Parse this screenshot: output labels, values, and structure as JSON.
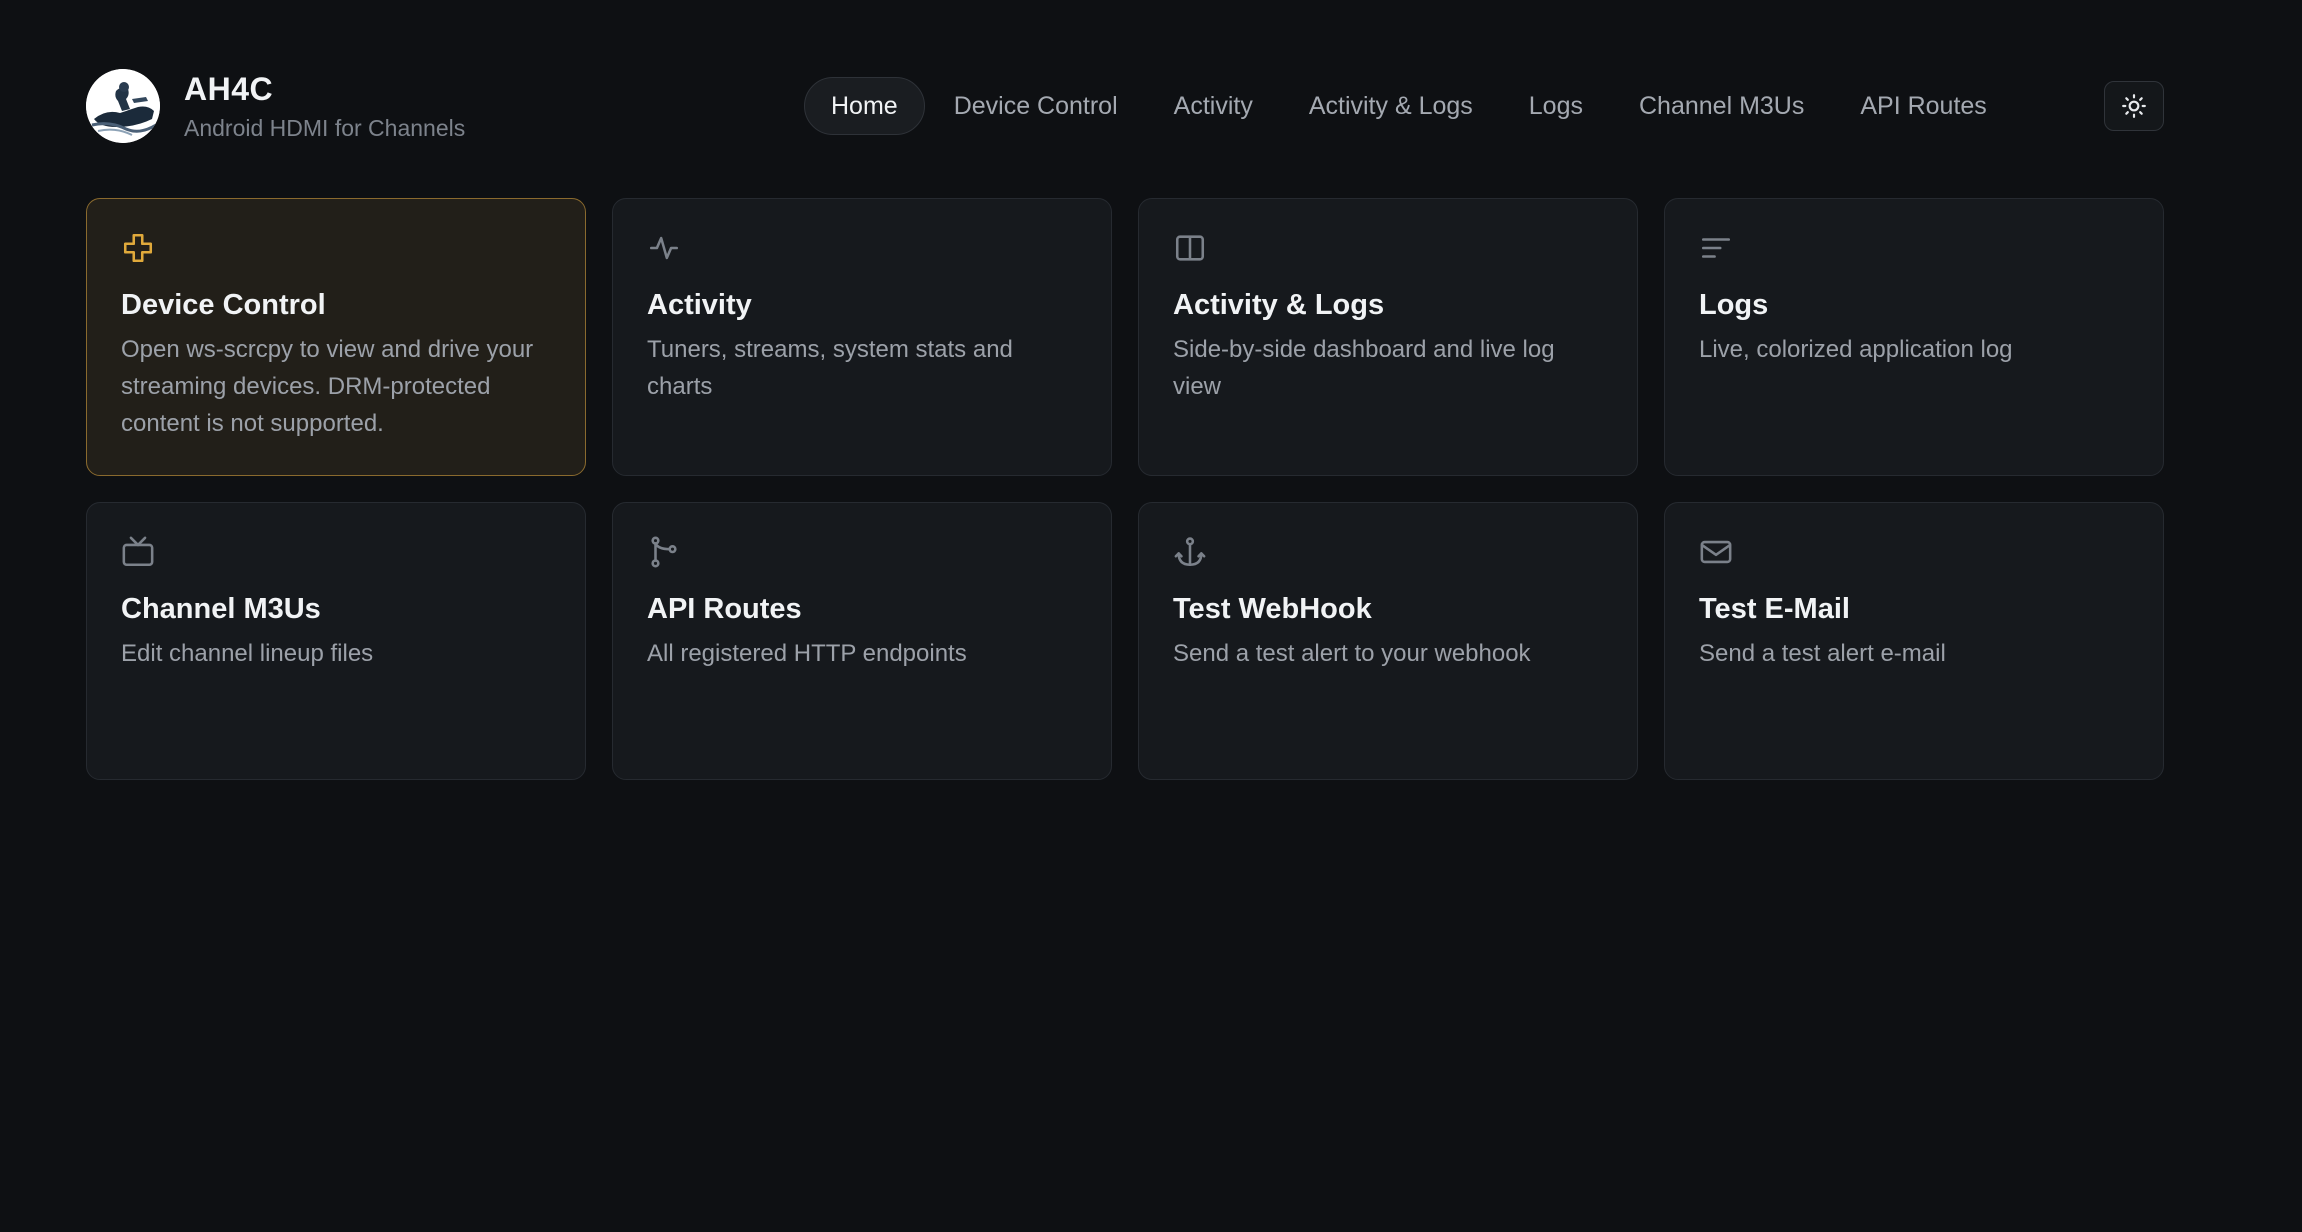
{
  "brand": {
    "title": "AH4C",
    "subtitle": "Android HDMI for Channels",
    "logo_icon": "rider-logo-icon"
  },
  "nav": {
    "items": [
      {
        "label": "Home",
        "active": true
      },
      {
        "label": "Device Control"
      },
      {
        "label": "Activity"
      },
      {
        "label": "Activity & Logs"
      },
      {
        "label": "Logs"
      },
      {
        "label": "Channel M3Us"
      },
      {
        "label": "API Routes"
      }
    ],
    "theme_toggle_icon": "sun-icon"
  },
  "cards": [
    {
      "title": "Device Control",
      "desc": "Open ws-scrcpy to view and drive your streaming devices. DRM-protected content is not supported.",
      "icon": "gamepad-cross-icon",
      "highlight": true
    },
    {
      "title": "Activity",
      "desc": "Tuners, streams, system stats and charts",
      "icon": "pulse-icon"
    },
    {
      "title": "Activity & Logs",
      "desc": "Side-by-side dashboard and live log view",
      "icon": "split-panel-icon"
    },
    {
      "title": "Logs",
      "desc": "Live, colorized application log",
      "icon": "lines-icon"
    },
    {
      "title": "Channel M3Us",
      "desc": "Edit channel lineup files",
      "icon": "tv-icon"
    },
    {
      "title": "API Routes",
      "desc": "All registered HTTP endpoints",
      "icon": "route-icon"
    },
    {
      "title": "Test WebHook",
      "desc": "Send a test alert to your webhook",
      "icon": "anchor-icon"
    },
    {
      "title": "Test E-Mail",
      "desc": "Send a test alert e-mail",
      "icon": "mail-icon"
    }
  ],
  "colors": {
    "background": "#0e1013",
    "card": "#16191d",
    "accent": "#e0a93b",
    "icon_muted": "#7b818a"
  }
}
